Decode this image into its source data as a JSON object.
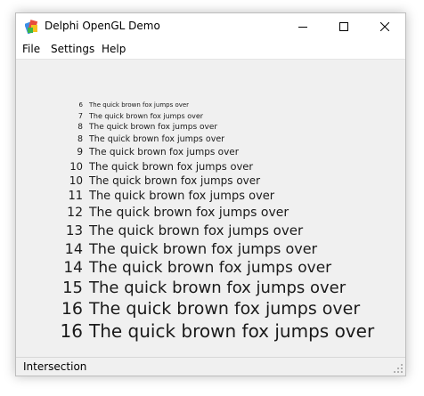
{
  "window": {
    "title": "Delphi OpenGL Demo",
    "icon": "delphi-app-icon"
  },
  "caption_buttons": {
    "minimize_icon": "minimize-icon",
    "maximize_icon": "maximize-icon",
    "close_icon": "close-icon"
  },
  "menu": {
    "items": [
      {
        "label": "File"
      },
      {
        "label": "Settings"
      },
      {
        "label": "Help"
      }
    ]
  },
  "content": {
    "lines": [
      {
        "size": "6",
        "text": "The quick brown fox jumps over"
      },
      {
        "size": "7",
        "text": "The quick brown fox jumps over"
      },
      {
        "size": "8",
        "text": "The quick brown fox jumps over"
      },
      {
        "size": "8",
        "text": "The quick brown fox jumps over"
      },
      {
        "size": "9",
        "text": "The quick brown fox jumps over"
      },
      {
        "size": "10",
        "text": "The quick brown fox jumps over"
      },
      {
        "size": "10",
        "text": "The quick brown fox jumps over"
      },
      {
        "size": "11",
        "text": "The quick brown fox jumps over"
      },
      {
        "size": "12",
        "text": "The quick brown fox jumps over"
      },
      {
        "size": "13",
        "text": "The quick brown fox jumps over"
      },
      {
        "size": "14",
        "text": "The quick brown fox jumps over"
      },
      {
        "size": "14",
        "text": "The quick brown fox jumps over"
      },
      {
        "size": "15",
        "text": "The quick brown fox jumps over"
      },
      {
        "size": "16",
        "text": "The quick brown fox jumps over"
      },
      {
        "size": "16",
        "text": "The quick brown fox jumps over"
      }
    ]
  },
  "statusbar": {
    "text": "Intersection"
  },
  "colors": {
    "titlebar_bg": "#ffffff",
    "client_bg": "#f0f0f0",
    "text": "#1a1a1a"
  }
}
